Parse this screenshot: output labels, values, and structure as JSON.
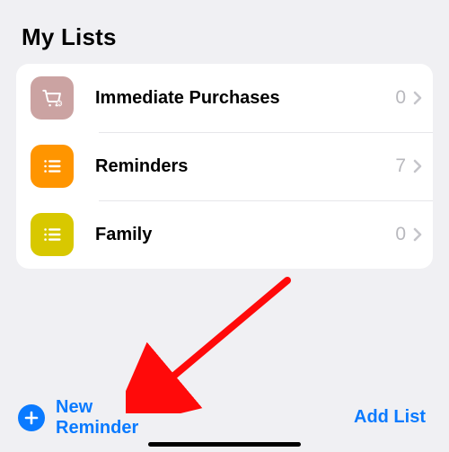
{
  "section_title": "My Lists",
  "lists": [
    {
      "name": "Immediate Purchases",
      "count": 0,
      "icon": "cart-gear-icon",
      "bg": "#cba3a2"
    },
    {
      "name": "Reminders",
      "count": 7,
      "icon": "list-bullet-icon",
      "bg": "#ff9500"
    },
    {
      "name": "Family",
      "count": 0,
      "icon": "list-bullet-icon",
      "bg": "#d8c800"
    }
  ],
  "toolbar": {
    "new_reminder_label": "New\nReminder",
    "add_list_label": "Add List"
  },
  "accent": "#0a7aff"
}
